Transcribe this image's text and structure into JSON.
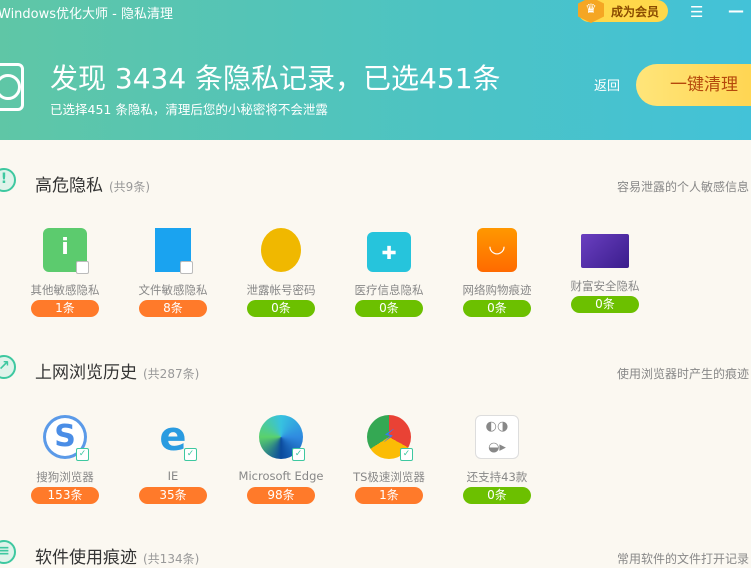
{
  "window": {
    "title": "Windows优化大师 - 隐私清理",
    "vip_label": "成为会员"
  },
  "summary": {
    "headline": "发现 3434 条隐私记录，已选451条",
    "subtitle": "已选择451 条隐私，清理后您的小秘密将不会泄露",
    "back_label": "返回",
    "clean_label": "一键清理"
  },
  "colors": {
    "orange": "#ff7a2a",
    "green": "#6cc000",
    "accent": "#3ec8a0"
  },
  "sections": [
    {
      "title": "高危隐私",
      "count": "(共9条)",
      "desc": "容易泄露的个人敏感信息",
      "items": [
        {
          "label": "其他敏感隐私",
          "count": "1条",
          "status": "orange",
          "icon": "info-bubble-icon",
          "checked": false
        },
        {
          "label": "文件敏感隐私",
          "count": "8条",
          "status": "orange",
          "icon": "document-icon",
          "checked": false
        },
        {
          "label": "泄露帐号密码",
          "count": "0条",
          "status": "green",
          "icon": "user-icon",
          "checked": null
        },
        {
          "label": "医疗信息隐私",
          "count": "0条",
          "status": "green",
          "icon": "medical-kit-icon",
          "checked": null
        },
        {
          "label": "网络购物痕迹",
          "count": "0条",
          "status": "green",
          "icon": "shopping-bag-icon",
          "checked": null
        },
        {
          "label": "财富安全隐私",
          "count": "0条",
          "status": "green",
          "icon": "credit-card-icon",
          "checked": null
        }
      ]
    },
    {
      "title": "上网浏览历史",
      "count": "(共287条)",
      "desc": "使用浏览器时产生的痕迹",
      "items": [
        {
          "label": "搜狗浏览器",
          "count": "153条",
          "status": "orange",
          "icon": "sogou-browser-icon",
          "checked": true
        },
        {
          "label": "IE",
          "count": "35条",
          "status": "orange",
          "icon": "ie-icon",
          "checked": true
        },
        {
          "label": "Microsoft Edge",
          "count": "98条",
          "status": "orange",
          "icon": "edge-icon",
          "checked": true
        },
        {
          "label": "TS极速浏览器",
          "count": "1条",
          "status": "orange",
          "icon": "ts-browser-icon",
          "checked": true
        },
        {
          "label": "还支持43款",
          "count": "0条",
          "status": "green",
          "icon": "more-browsers-icon",
          "checked": null
        }
      ]
    },
    {
      "title": "软件使用痕迹",
      "count": "(共134条)",
      "desc": "常用软件的文件打开记录"
    }
  ]
}
